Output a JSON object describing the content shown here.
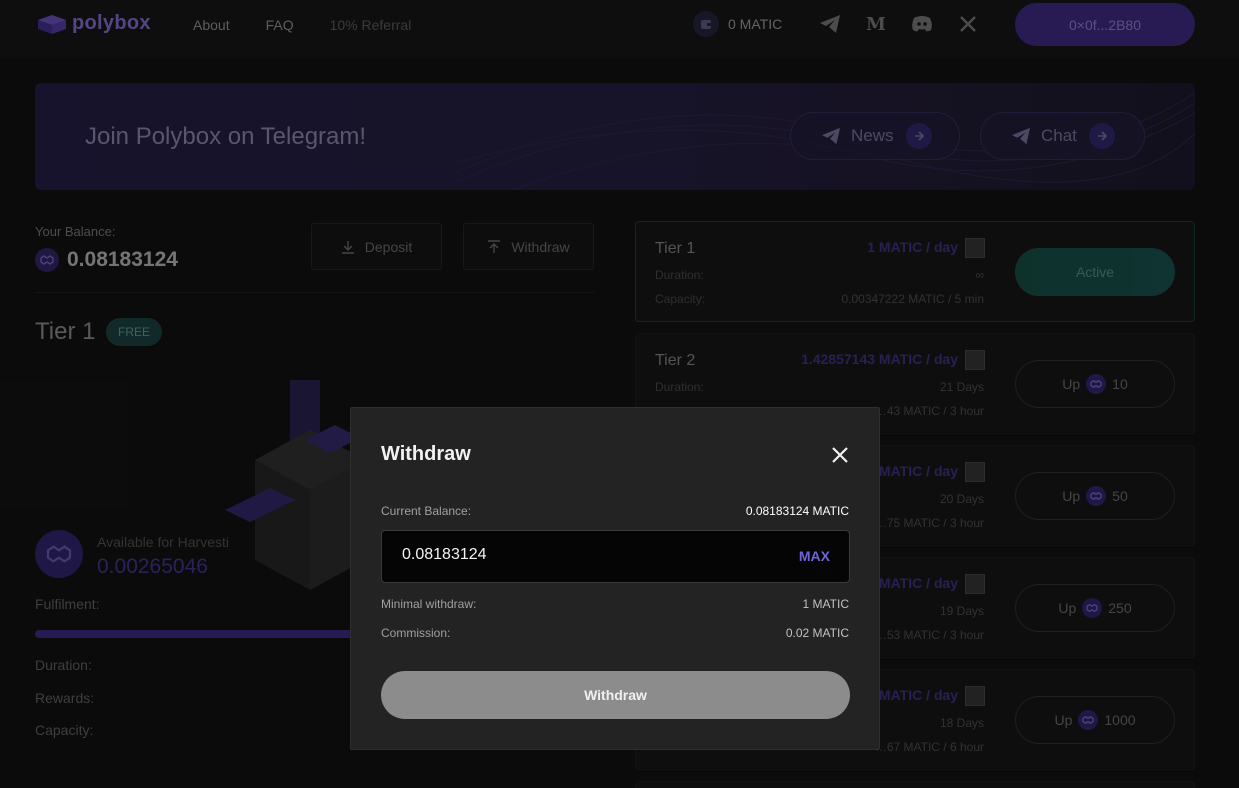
{
  "header": {
    "logo_text": "polybox",
    "nav": [
      {
        "label": "About"
      },
      {
        "label": "FAQ"
      },
      {
        "label": "10% Referral"
      }
    ],
    "wallet_balance": "0 MATIC",
    "socials": [
      "telegram-icon",
      "medium-icon",
      "discord-icon",
      "x-icon"
    ],
    "address": "0×0f...2B80"
  },
  "banner": {
    "title": "Join Polybox on Telegram!",
    "news_label": "News",
    "chat_label": "Chat"
  },
  "balance": {
    "label": "Your Balance:",
    "value": "0.08183124",
    "deposit_label": "Deposit",
    "withdraw_label": "Withdraw"
  },
  "current_tier": {
    "title": "Tier 1",
    "badge": "FREE",
    "harvest_label": "Available for Harvesti",
    "harvest_value": "0.00265046",
    "fulfilment_label": "Fulfilment:",
    "duration_label": "Duration:",
    "rewards_label": "Rewards:",
    "capacity_label": "Capacity:"
  },
  "tiers": [
    {
      "name": "Tier 1",
      "rate": "1 MATIC / day",
      "duration_label": "Duration:",
      "duration": "∞",
      "capacity_label": "Capacity:",
      "capacity": "0.00347222 MATIC / 5 min",
      "button": "Active",
      "price": ""
    },
    {
      "name": "Tier 2",
      "rate": "1.42857143 MATIC / day",
      "duration_label": "Duration:",
      "duration": "21 Days",
      "capacity_label": "",
      "capacity": "…43 MATIC / 3 hour",
      "button": "Up",
      "price": "10"
    },
    {
      "name": "",
      "rate": "MATIC / day",
      "duration_label": "",
      "duration": "20 Days",
      "capacity_label": "",
      "capacity": "…75 MATIC / 3 hour",
      "button": "Up",
      "price": "50"
    },
    {
      "name": "",
      "rate": "MATIC / day",
      "duration_label": "",
      "duration": "19 Days",
      "capacity_label": "",
      "capacity": "…53 MATIC / 3 hour",
      "button": "Up",
      "price": "250"
    },
    {
      "name": "",
      "rate": "MATIC / day",
      "duration_label": "",
      "duration": "18 Days",
      "capacity_label": "",
      "capacity": "…67 MATIC / 6 hour",
      "button": "Up",
      "price": "1000"
    }
  ],
  "modal": {
    "title": "Withdraw",
    "current_balance_label": "Current Balance:",
    "current_balance_value": "0.08183124 MATIC",
    "amount_value": "0.08183124",
    "max_label": "MAX",
    "minimal_label": "Minimal withdraw:",
    "minimal_value": "1 MATIC",
    "commission_label": "Commission:",
    "commission_value": "0.02 MATIC",
    "submit_label": "Withdraw"
  }
}
